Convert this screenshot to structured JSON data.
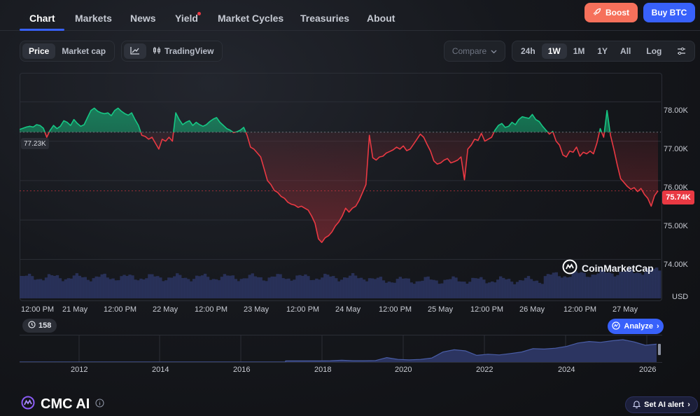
{
  "nav": {
    "tabs": [
      {
        "label": "Chart",
        "active": true
      },
      {
        "label": "Markets"
      },
      {
        "label": "News"
      },
      {
        "label": "Yield",
        "dot": true
      },
      {
        "label": "Market Cycles"
      },
      {
        "label": "Treasuries"
      },
      {
        "label": "About"
      }
    ],
    "boost_label": "Boost",
    "buy_label": "Buy BTC"
  },
  "toolbar": {
    "metric_options": [
      {
        "label": "Price",
        "active": true
      },
      {
        "label": "Market cap"
      }
    ],
    "tradingview_label": "TradingView",
    "compare_label": "Compare",
    "ranges": [
      {
        "label": "24h"
      },
      {
        "label": "1W",
        "active": true
      },
      {
        "label": "1M"
      },
      {
        "label": "1Y"
      },
      {
        "label": "All"
      }
    ],
    "log_label": "Log"
  },
  "chart_data": {
    "type": "line",
    "series": [
      {
        "values": [
          77.3,
          77.33,
          77.36,
          77.38,
          77.36,
          77.42,
          77.4,
          77.33,
          77.1,
          77.28,
          77.4,
          77.32,
          77.38,
          77.52,
          77.48,
          77.4,
          77.55,
          77.45,
          77.38,
          77.42,
          77.6,
          77.78,
          77.84,
          77.76,
          77.72,
          77.7,
          77.72,
          77.65,
          77.78,
          77.84,
          77.76,
          77.7,
          77.66,
          77.72,
          77.55,
          77.4,
          77.15,
          77.12,
          77.05,
          77.1,
          76.95,
          76.8,
          77.05,
          77.0,
          77.1,
          77.0,
          77.72,
          77.55,
          77.42,
          77.48,
          77.52,
          77.4,
          77.48,
          77.42,
          77.38,
          77.42,
          77.5,
          77.56,
          77.6,
          77.48,
          77.4,
          77.32,
          77.28,
          77.22,
          77.24,
          77.28,
          77.35,
          77.15,
          76.85,
          76.8,
          76.7,
          76.6,
          76.3,
          76.0,
          75.9,
          75.75,
          75.7,
          75.6,
          75.55,
          75.45,
          75.4,
          75.38,
          75.32,
          75.35,
          75.3,
          75.25,
          75.1,
          74.92,
          74.52,
          74.43,
          74.55,
          74.6,
          74.7,
          74.85,
          74.95,
          75.1,
          75.3,
          75.2,
          75.3,
          75.35,
          75.5,
          75.7,
          75.9,
          77.15,
          76.58,
          76.52,
          76.6,
          76.62,
          76.7,
          76.74,
          76.78,
          76.85,
          76.8,
          76.88,
          76.76,
          76.8,
          76.92,
          77.05,
          77.18,
          77.1,
          76.92,
          76.75,
          76.5,
          76.42,
          76.45,
          76.52,
          76.56,
          76.45,
          76.48,
          76.52,
          76.6,
          76.02,
          76.8,
          76.9,
          77.05,
          77.02,
          77.2,
          77.0,
          77.05,
          77.1,
          77.28,
          77.4,
          77.45,
          77.35,
          77.38,
          77.48,
          77.42,
          77.55,
          77.62,
          77.6,
          77.58,
          77.68,
          77.55,
          77.5,
          77.38,
          77.28,
          77.18,
          77.25,
          77.0,
          76.9,
          76.65,
          76.6,
          76.75,
          76.72,
          76.85,
          76.62,
          76.72,
          76.68,
          76.75,
          76.68,
          76.95,
          77.32,
          77.1,
          77.78,
          77.15,
          76.8,
          76.4,
          76.05,
          75.95,
          75.85,
          75.78,
          75.82,
          75.72,
          75.8,
          75.65,
          75.55,
          75.35,
          75.62,
          75.74
        ]
      }
    ],
    "baseline": 77.23,
    "ylim": [
      73.9,
      78.7
    ],
    "ytick_labels": [
      "78.00K",
      "77.00K",
      "76.00K",
      "75.00K",
      "74.00K"
    ],
    "y_unit": "USD",
    "last_price_label": "75.74K",
    "open_price_label": "77.23K",
    "xtick_labels": [
      "12:00 PM",
      "21 May",
      "12:00 PM",
      "22 May",
      "12:00 PM",
      "23 May",
      "12:00 PM",
      "24 May",
      "12:00 PM",
      "25 May",
      "12:00 PM",
      "26 May",
      "12:00 PM",
      "27 May"
    ],
    "colors": {
      "up": "#16c784",
      "down": "#ea3943"
    },
    "mini_series": [
      0.05,
      0.05,
      0.05,
      0.05,
      0.06,
      0.08,
      0.06,
      0.06,
      0.07,
      0.2,
      0.12,
      0.1,
      0.12,
      0.18,
      0.45,
      0.55,
      0.5,
      0.3,
      0.35,
      0.32,
      0.38,
      0.45,
      0.6,
      0.58,
      0.62,
      0.7,
      0.85,
      0.92,
      0.88,
      0.95,
      1.0,
      0.9,
      0.75,
      0.8
    ],
    "year_labels": [
      "2012",
      "2014",
      "2016",
      "2018",
      "2020",
      "2022",
      "2024",
      "2026"
    ]
  },
  "watermark": "CoinMarketCap",
  "events_badge": "158",
  "analyze_label": "Analyze",
  "ai": {
    "title": "CMC AI",
    "alert_label": "Set AI alert"
  }
}
